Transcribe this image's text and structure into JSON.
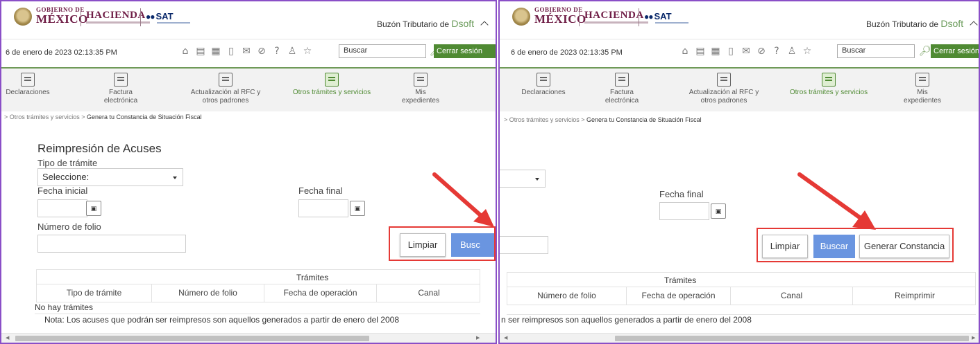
{
  "header": {
    "gob_line1": "GOBIERNO DE",
    "gob_line2": "MÉXICO",
    "hacienda": "HACIENDA",
    "sat": "SAT",
    "buzon_label": "Buzón Tributario de",
    "user": "Dsoft"
  },
  "toolbar": {
    "datetime": "6 de enero de 2023 02:13:35 PM",
    "search_placeholder": "Buscar",
    "logout_label": "Cerrar sesión",
    "icons": [
      "home-icon",
      "document-icon",
      "calendar-icon",
      "book-icon",
      "mail-icon",
      "compass-icon",
      "help-icon",
      "user-icon",
      "star-icon"
    ]
  },
  "nav": {
    "items": [
      {
        "line1": "Declaraciones",
        "line2": ""
      },
      {
        "line1": "Factura",
        "line2": "electrónica"
      },
      {
        "line1": "Actualización al RFC y",
        "line2": "otros padrones"
      },
      {
        "line1": "Otros trámites y servicios",
        "line2": ""
      },
      {
        "line1": "Mis",
        "line2": "expedientes"
      }
    ],
    "active_index": 3
  },
  "breadcrumb": {
    "prefix": "> Otros trámites y servicios > ",
    "current": "Genera tu Constancia de Situación Fiscal"
  },
  "form": {
    "title": "Reimpresión de Acuses",
    "tipo_label": "Tipo de trámite",
    "tipo_value": "Seleccione:",
    "fecha_inicial_label": "Fecha inicial",
    "fecha_final_label": "Fecha final",
    "folio_label": "Número de folio",
    "btn_limpiar": "Limpiar",
    "btn_buscar": "Buscar",
    "btn_buscar_cut": "Busc",
    "btn_generar": "Generar Constancia"
  },
  "table": {
    "caption": "Trámites",
    "columns": [
      "Tipo de trámite",
      "Número de folio",
      "Fecha de operación",
      "Canal",
      "Reimprimir"
    ],
    "empty": "No hay trámites",
    "note": "Nota: Los acuses que podrán ser reimpresos son aquellos generados a partir de enero del 2008",
    "note_cut": "n ser reimpresos son aquellos generados a partir de enero del 2008"
  },
  "colors": {
    "brand": "#6f1d46",
    "green": "#4f8a33",
    "primary_button": "#6a95e0",
    "highlight": "#e53935",
    "frame": "#8a4fc7"
  }
}
